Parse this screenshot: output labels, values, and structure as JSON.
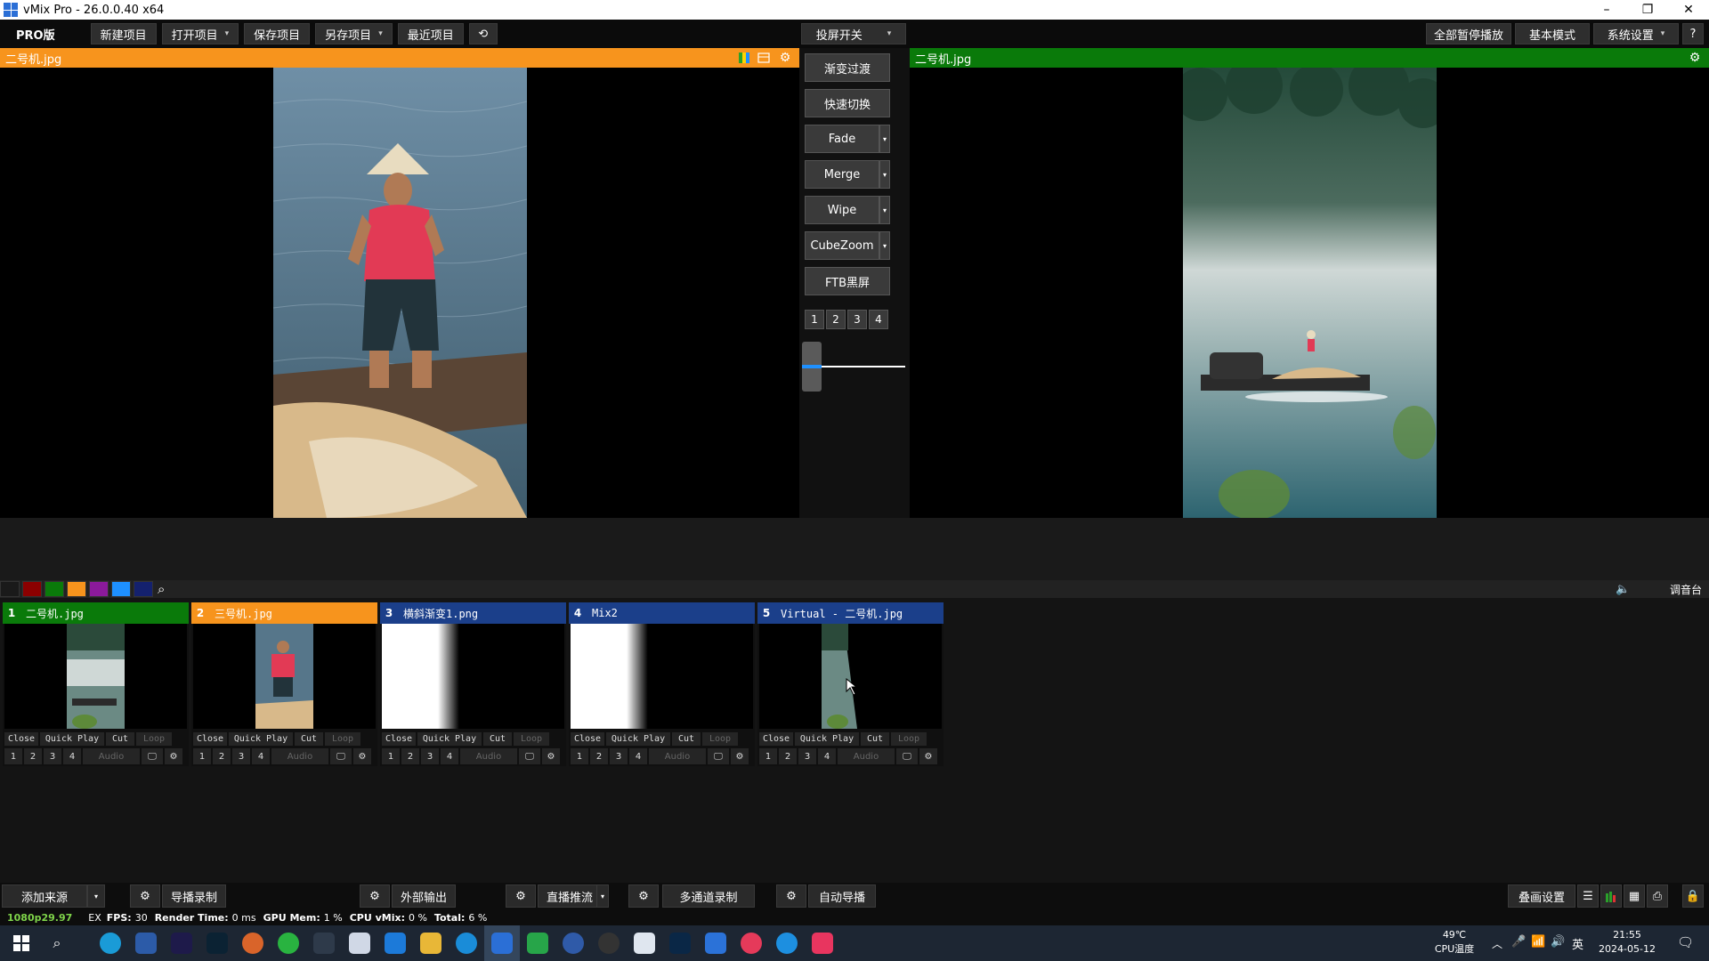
{
  "window": {
    "title": "vMix Pro - 26.0.0.40 x64",
    "minimize": "–",
    "maximize": "❐",
    "close": "✕"
  },
  "menu": {
    "edition": "PRO版",
    "new_project": "新建项目",
    "open_project": "打开项目",
    "save_project": "保存项目",
    "save_as": "另存项目",
    "recent": "最近项目",
    "refresh_icon": "⟲",
    "screen_switch": "投屏开关",
    "pause_all": "全部暂停播放",
    "basic_mode": "基本模式",
    "settings": "系统设置",
    "help": "?"
  },
  "preview": {
    "title": "二号机.jpg",
    "header_color": "#f7941d"
  },
  "output": {
    "title": "二号机.jpg",
    "header_color": "#0a7a0a"
  },
  "transitions": {
    "fade_over": "渐变过渡",
    "quick_cut": "快速切换",
    "fade": "Fade",
    "merge": "Merge",
    "wipe": "Wipe",
    "cubezoom": "CubeZoom",
    "ftb": "FTB黑屏",
    "numbers": [
      "1",
      "2",
      "3",
      "4"
    ],
    "tbar_level": 0
  },
  "color_swatches": [
    "#1a1a1a",
    "#8b0000",
    "#0a7a0a",
    "#f7941d",
    "#8b1a9b",
    "#1e90ff",
    "#14216e"
  ],
  "audio_mixer": {
    "label": "调音台"
  },
  "inputs": [
    {
      "num": "1",
      "name": "二号机.jpg",
      "header_color": "#0a7a0a"
    },
    {
      "num": "2",
      "name": "三号机.jpg",
      "header_color": "#f7941d"
    },
    {
      "num": "3",
      "name": "横斜渐变1.png",
      "header_color": "#1b3f8a"
    },
    {
      "num": "4",
      "name": "Mix2",
      "header_color": "#1b3f8a"
    },
    {
      "num": "5",
      "name": "Virtual - 二号机.jpg",
      "header_color": "#1b3f8a"
    }
  ],
  "tile_controls": {
    "close": "Close",
    "quick_play": "Quick Play",
    "cut": "Cut",
    "loop": "Loop",
    "audio": "Audio",
    "nums": [
      "1",
      "2",
      "3",
      "4"
    ]
  },
  "bottom": {
    "add_input": "添加来源",
    "record": "导播录制",
    "external": "外部输出",
    "stream": "直播推流",
    "multicorder": "多通道录制",
    "playlist": "自动导播",
    "overlay": "叠画设置"
  },
  "status": {
    "format": "1080p29.97",
    "ex": "EX",
    "fps_label": "FPS:",
    "fps": "30",
    "render_label": "Render Time:",
    "render": "0 ms",
    "gpu_label": "GPU Mem:",
    "gpu": "1 %",
    "cpu_label": "CPU vMix:",
    "cpu": "0 %",
    "total_label": "Total:",
    "total": "6 %"
  },
  "taskbar": {
    "temp": "49℃",
    "temp_label": "CPU温度",
    "lang": "英",
    "time": "21:55",
    "date": "2024-05-12"
  }
}
